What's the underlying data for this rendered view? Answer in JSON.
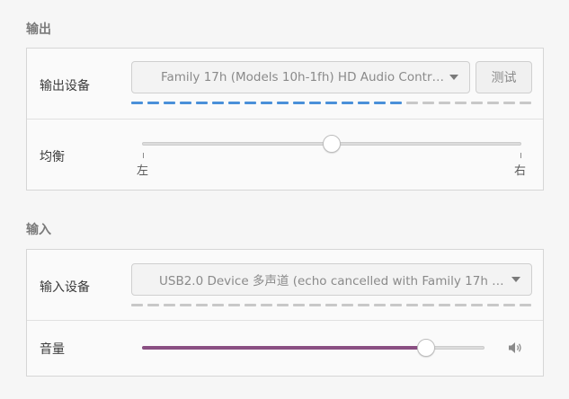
{
  "output": {
    "section_title": "输出",
    "device_label": "输出设备",
    "device_value": "Family 17h (Models 10h-1fh) HD Audio Contr…",
    "test_button": "测试",
    "balance_label": "均衡",
    "balance_left": "左",
    "balance_right": "右",
    "balance_value": 0.5,
    "level_fraction": 0.66
  },
  "input": {
    "section_title": "输入",
    "device_label": "输入设备",
    "device_value": "USB2.0 Device 多声道 (echo cancelled with Family 17h (…",
    "volume_label": "音量",
    "volume_value": 0.83,
    "level_fraction": 0.0
  },
  "colors": {
    "level_active": "#4a90d9",
    "level_inactive": "#c8c8c8",
    "volume_fill": "#8a4f82"
  },
  "icons": {
    "combo_arrow": "chevron-down-icon",
    "volume": "speaker-icon"
  }
}
